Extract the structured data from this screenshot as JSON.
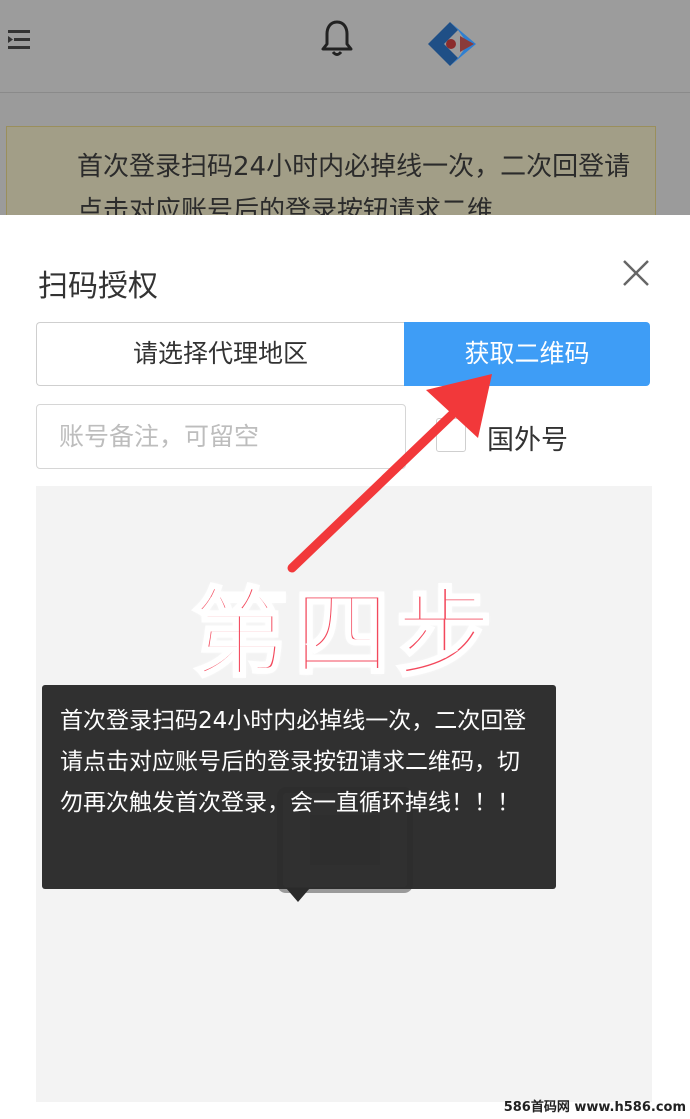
{
  "background": {
    "notice_text": "首次登录扫码24小时内必掉线一次，二次回登请点击对应账号后的登录按钮请求二维"
  },
  "modal": {
    "title": "扫码授权",
    "region_select": "请选择代理地区",
    "qr_button": "获取二维码",
    "note_placeholder": "账号备注，可留空",
    "foreign_label": "国外号"
  },
  "annotation": {
    "step_label": "第四步"
  },
  "tooltip": {
    "text": "首次登录扫码24小时内必掉线一次，二次回登请点击对应账号后的登录按钮请求二维码，切勿再次触发首次登录，会一直循环掉线！！！"
  },
  "watermark": "586首码网 www.h586.com",
  "colors": {
    "accent": "#3e9df6",
    "step_label": "#f3485c",
    "arrow": "#f2383a",
    "tooltip_bg": "#2a2a2a"
  },
  "icons": [
    "menu-icon",
    "bell-icon",
    "logo-icon",
    "close-icon",
    "checkbox",
    "qr-placeholder-icon"
  ]
}
